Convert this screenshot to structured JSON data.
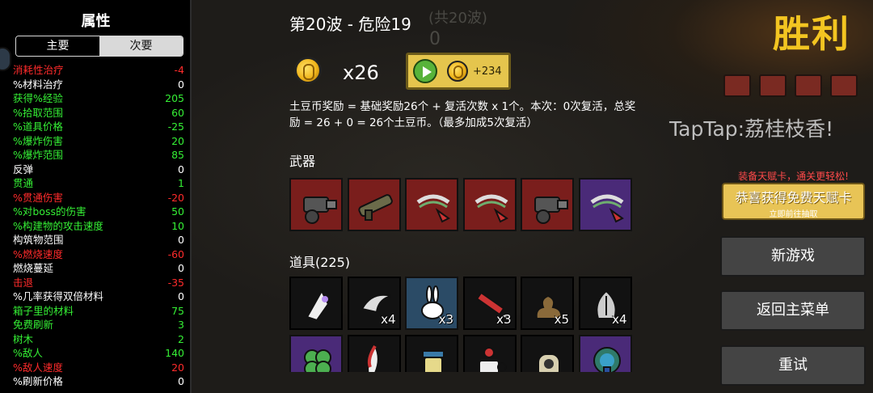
{
  "left_panel": {
    "title": "属性",
    "tabs": [
      {
        "label": "主要",
        "active": true
      },
      {
        "label": "次要",
        "active": false
      }
    ],
    "stats": [
      {
        "name": "消耗性治疗",
        "value": "-4",
        "color": "red"
      },
      {
        "name": "%材料治疗",
        "value": "0",
        "color": "white"
      },
      {
        "name": "获得%经验",
        "value": "205",
        "color": "green"
      },
      {
        "name": "%拾取范围",
        "value": "60",
        "color": "green"
      },
      {
        "name": "%道具价格",
        "value": "-25",
        "color": "green"
      },
      {
        "name": "%爆炸伤害",
        "value": "20",
        "color": "green"
      },
      {
        "name": "%爆炸范围",
        "value": "85",
        "color": "green"
      },
      {
        "name": "反弹",
        "value": "0",
        "color": "white"
      },
      {
        "name": "贯通",
        "value": "1",
        "color": "green"
      },
      {
        "name": "%贯通伤害",
        "value": "-20",
        "color": "red"
      },
      {
        "name": "%对boss的伤害",
        "value": "50",
        "color": "green"
      },
      {
        "name": "%构建物的攻击速度",
        "value": "10",
        "color": "green"
      },
      {
        "name": "构筑物范围",
        "value": "0",
        "color": "white"
      },
      {
        "name": "%燃烧速度",
        "value": "-60",
        "color": "red"
      },
      {
        "name": "燃烧蔓延",
        "value": "0",
        "color": "white"
      },
      {
        "name": "击退",
        "value": "-35",
        "color": "red"
      },
      {
        "name": "%几率获得双倍材料",
        "value": "0",
        "color": "white"
      },
      {
        "name": "箱子里的材料",
        "value": "75",
        "color": "green"
      },
      {
        "name": "免费刷新",
        "value": "3",
        "color": "green"
      },
      {
        "name": "树木",
        "value": "2",
        "color": "green"
      },
      {
        "name": "%敌人",
        "value": "140",
        "color": "green"
      },
      {
        "name": "%敌人速度",
        "value": "20",
        "color": "red"
      },
      {
        "name": "%刷新价格",
        "value": "0",
        "color": "white"
      }
    ]
  },
  "center": {
    "wave_title": "第20波 - 危险19",
    "background_wave_text": "(共20波)",
    "background_zero": "0",
    "coin_count": "x26",
    "revive_button": {
      "amount": "+234"
    },
    "reward_text": "土豆币奖励 = 基础奖励26个 + 复活次数 x 1个。本次：0次复活，总奖励 = 26 + 0 = 26个土豆币。（最多加成5次复活）",
    "weapons_label": "武器",
    "weapons": [
      {
        "icon": "minigun-icon",
        "tier": "red"
      },
      {
        "icon": "rocket-launcher-icon",
        "tier": "red"
      },
      {
        "icon": "chain-claw-icon",
        "tier": "red"
      },
      {
        "icon": "chain-claw-icon",
        "tier": "red"
      },
      {
        "icon": "minigun-icon",
        "tier": "red"
      },
      {
        "icon": "chain-claw-icon",
        "tier": "purple"
      }
    ],
    "items_label": "道具(225)",
    "items": [
      {
        "icon": "tooth-icon",
        "tier": "dark",
        "count": ""
      },
      {
        "icon": "claw-icon",
        "tier": "dark",
        "count": "x4"
      },
      {
        "icon": "rabbit-icon",
        "tier": "blue",
        "count": "x3"
      },
      {
        "icon": "syringe-icon",
        "tier": "dark",
        "count": "x3"
      },
      {
        "icon": "poop-icon",
        "tier": "dark",
        "count": "x5"
      },
      {
        "icon": "fossil-icon",
        "tier": "dark",
        "count": "x4"
      },
      {
        "icon": "clover-icon",
        "tier": "purple",
        "count": ""
      },
      {
        "icon": "feather-icon",
        "tier": "dark",
        "count": ""
      },
      {
        "icon": "jar-icon",
        "tier": "dark",
        "count": ""
      },
      {
        "icon": "coffee-icon",
        "tier": "dark",
        "count": ""
      },
      {
        "icon": "turret-icon",
        "tier": "dark",
        "count": ""
      },
      {
        "icon": "peacock-icon",
        "tier": "purple",
        "count": ""
      }
    ]
  },
  "right_panel": {
    "victory": "胜利",
    "tap_text": "TapTap:荔桂枝香!",
    "talent_note": "装备天赋卡，通关更轻松!",
    "talent_main": "恭喜获得免费天赋卡",
    "talent_sub": "立即前往抽取",
    "new_game": "新游戏",
    "main_menu": "返回主菜单",
    "retry": "重试"
  },
  "colors": {
    "red": "#ff2b2b",
    "green": "#35f035",
    "white": "#ffffff",
    "victory": "#f3c521",
    "tier_red": "#7a1e1c",
    "tier_purple": "#4a2a78",
    "tier_blue": "#2b4b66"
  }
}
